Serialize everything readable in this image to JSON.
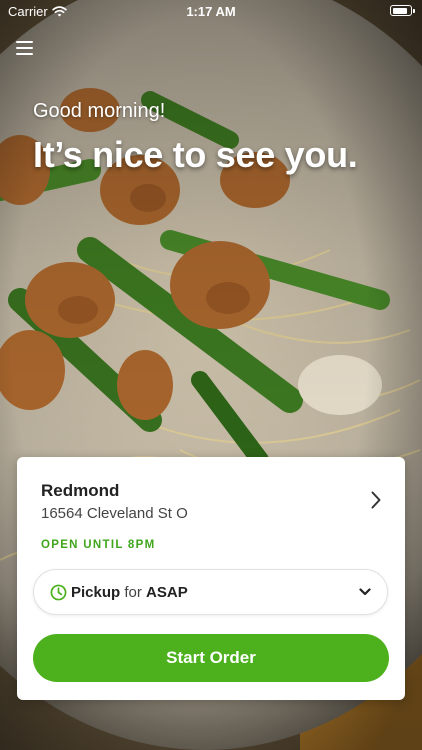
{
  "status_bar": {
    "carrier": "Carrier",
    "time": "1:17 AM",
    "battery_level_fraction": 0.9
  },
  "header": {
    "greeting": "Good morning!",
    "headline": "It’s nice to see you."
  },
  "store": {
    "name": "Redmond",
    "address": "16564 Cleveland St O",
    "hours": "OPEN UNTIL 8PM"
  },
  "pickup": {
    "method": "Pickup",
    "connector": "for",
    "time": "ASAP"
  },
  "actions": {
    "start_order": "Start Order"
  },
  "colors": {
    "accent_green": "#4cb11c",
    "hours_green": "#3fa61c"
  },
  "icons": {
    "menu": "hamburger-menu-icon",
    "store_chevron": "chevron-right-icon",
    "pickup_clock": "clock-icon",
    "pickup_dropdown": "chevron-down-icon"
  }
}
